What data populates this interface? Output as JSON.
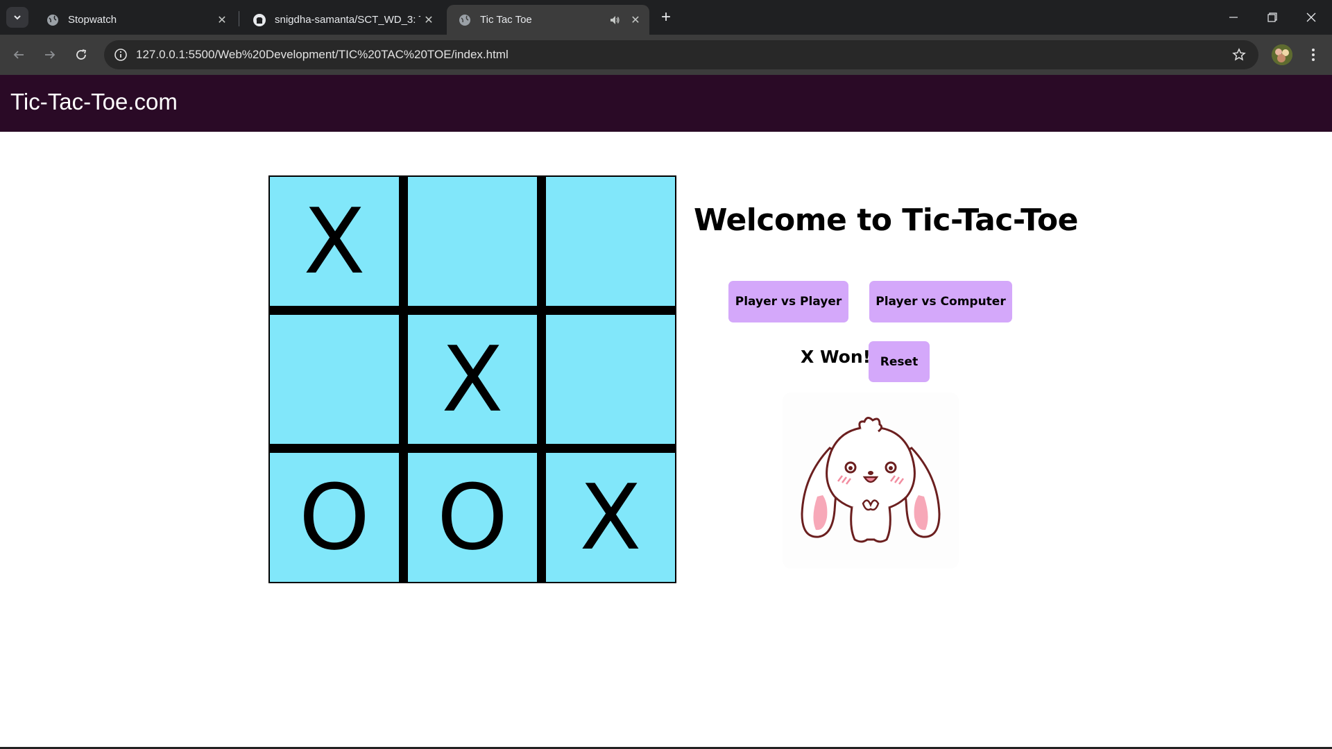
{
  "browser": {
    "tabs": [
      {
        "title": "Stopwatch",
        "icon": "globe-icon",
        "active": false
      },
      {
        "title": "snigdha-samanta/SCT_WD_3: Ti",
        "icon": "github-icon",
        "active": false
      },
      {
        "title": "Tic Tac Toe",
        "icon": "globe-icon",
        "active": true,
        "audio": true
      }
    ],
    "url": "127.0.0.1:5500/Web%20Development/TIC%20TAC%20TOE/index.html"
  },
  "page": {
    "site_title": "Tic-Tac-Toe.com",
    "heading": "Welcome to Tic-Tac-Toe",
    "buttons": {
      "pvp": "Player vs Player",
      "pvc": "Player vs Computer",
      "reset": "Reset"
    },
    "status": "X Won!",
    "board": [
      [
        "X",
        "",
        ""
      ],
      [
        "",
        "X",
        ""
      ],
      [
        "O",
        "O",
        "X"
      ]
    ],
    "image": "bunny-illustration"
  },
  "colors": {
    "header_bg": "#2a0a26",
    "cell_bg": "#81e7fa",
    "button_bg": "#d4a8fa"
  }
}
